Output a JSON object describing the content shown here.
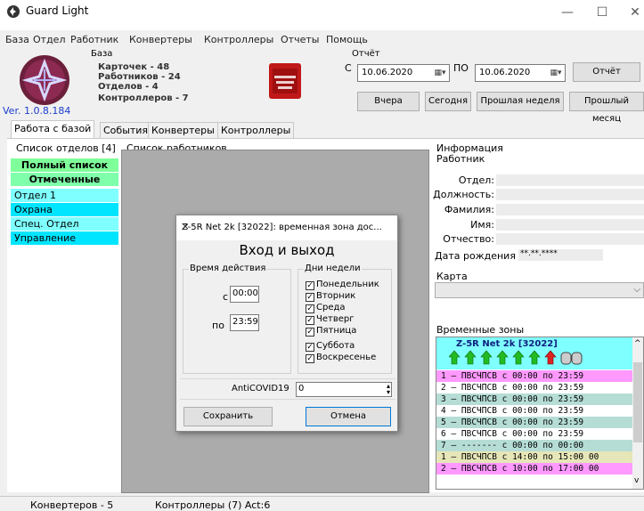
{
  "window": {
    "title": "Guard Light",
    "minimize_glyph": "—",
    "maximize_glyph": "☐",
    "close_glyph": "✕"
  },
  "menu": [
    "База",
    "Отдел",
    "Работник",
    "Конвертеры",
    "Контроллеры",
    "Отчеты",
    "Помощь"
  ],
  "stats": {
    "caption": "База",
    "cards": "Карточек - 48",
    "workers": "Работников - 24",
    "departments": "Отделов - 4",
    "controllers": "Контроллеров - 7"
  },
  "version": "Ver. 1.0.8.184",
  "report": {
    "caption": "Отчёт",
    "from_label": "С",
    "from_date": "10.06.2020",
    "to_label": "ПО",
    "to_date": "10.06.2020",
    "report_button": "Отчёт",
    "yesterday": "Вчера",
    "today": "Сегодня",
    "last_week": "Прошлая неделя",
    "last_month": "Прошлый месяц"
  },
  "tabs": [
    "Работа с базой",
    "События",
    "Конвертеры",
    "Контроллеры"
  ],
  "departments": {
    "caption": "Список отделов [4]",
    "items": [
      "Полный список",
      "Отмеченные",
      "Отдел 1",
      "Охрана",
      "Спец. Отдел",
      "Управление"
    ]
  },
  "workers_caption": "Список работников",
  "info": {
    "caption": "Информация",
    "worker_caption": "Работник",
    "dept": "Отдел:",
    "position": "Должность:",
    "surname": "Фамилия:",
    "name": "Имя:",
    "patronymic": "Отчество:",
    "birth": "Дата рождения",
    "birth_value": "**.**.****",
    "card_caption": "Карта"
  },
  "timezones": {
    "caption": "Временные зоны",
    "controller": "Z-5R Net 2k [32022]",
    "rows": [
      "1 – ПВСЧПСВ с 00:00 по 23:59",
      "2 – ПВСЧПСВ с 00:00 по 23:59",
      "3 – ПВСЧПСВ с 00:00 по 23:59",
      "4 – ПВСЧПСВ с 00:00 по 23:59",
      "5 – ПВСЧПСВ с 00:00 по 23:59",
      "6 – ПВСЧПСВ с 00:00 по 23:59",
      "7 – ------- с 00:00 по 00:00",
      "1 – ПВСЧПСВ с 14:00 по 15:00 00",
      "2 – ПВСЧПСВ с 10:00 по 17:00 00"
    ]
  },
  "status": {
    "converters": "Конвертеров - 5",
    "controllers": "Контроллеры (7) Act:6"
  },
  "dialog": {
    "title": "Z-5R Net 2k [32022]: временная зона дос...",
    "heading": "Вход и выход",
    "time_caption": "Время действия",
    "from_label": "с",
    "from_value": "00:00",
    "to_label": "по",
    "to_value": "23:59",
    "days_caption": "Дни недели",
    "days": [
      "Понедельник",
      "Вторник",
      "Среда",
      "Четверг",
      "Пятница",
      "Суббота",
      "Воскресенье"
    ],
    "zone_name_label": "AntiCOVID19",
    "zone_value": "0",
    "save": "Сохранить",
    "cancel": "Отмена"
  },
  "colors": {
    "dept_full": "#7fff99",
    "dept_marked": "#7fffaa",
    "dept_cyan1": "#7fffff",
    "dept_cyan2": "#00e5ff",
    "tz_pink": "#ff99ff",
    "tz_teal": "#b5ddd5",
    "tz_white": "#ffffff",
    "tz_yellow": "#e6e6b8",
    "version": "#1a3ccf"
  }
}
